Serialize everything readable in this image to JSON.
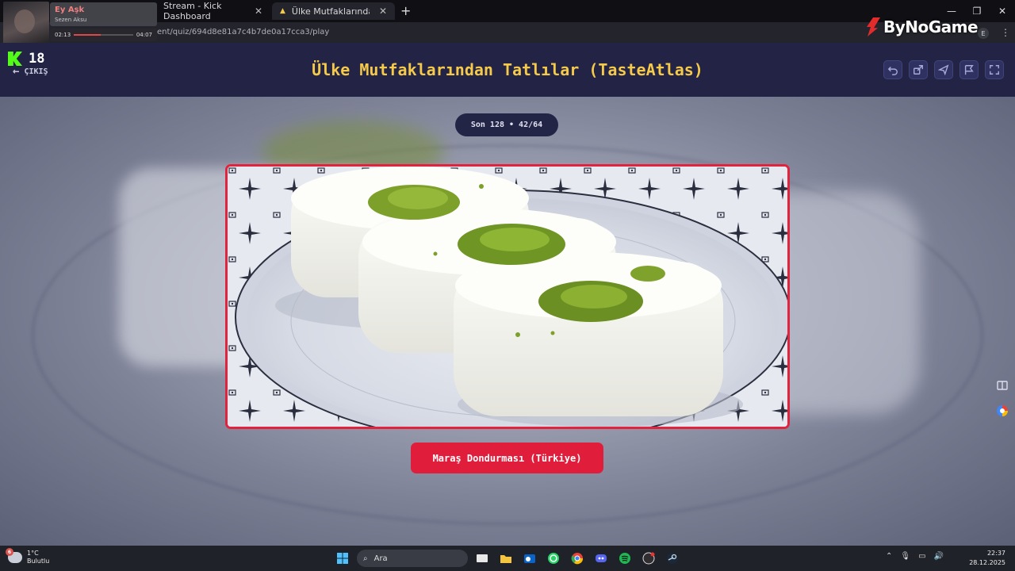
{
  "browser": {
    "tabs": [
      {
        "label": "Stream - Kick Dashboard"
      },
      {
        "label": "Ülke Mutfaklarından Tatlılar (Ta"
      }
    ],
    "url": "ent/quiz/694d8e81a7c4b7de0a17cca3/play",
    "profile_initial": "E"
  },
  "music_overlay": {
    "song": "Ey Aşk",
    "artist": "Sezen Aksu",
    "elapsed": "02:13",
    "total": "04:07",
    "progress": 0.45
  },
  "watermark": "ByNoGame",
  "header": {
    "kick_count": "18",
    "exit_label": "ÇIKIŞ",
    "title": "Ülke Mutfaklarından Tatlılar (TasteAtlas)",
    "tools": [
      "undo-icon",
      "share-icon",
      "send-icon",
      "flag-icon",
      "fullscreen-icon"
    ]
  },
  "quiz": {
    "round": "Son 128 • 42/64",
    "answer": "Maraş Dondurması (Türkiye)"
  },
  "colors": {
    "accent_red": "#e11d3c",
    "title_yellow": "#f5c94a",
    "header_bg": "#222345",
    "kick_green": "#53fc18"
  },
  "taskbar": {
    "weather_temp": "1°C",
    "weather_desc": "Bulutlu",
    "weather_badge": "6",
    "search_placeholder": "Ara",
    "time": "22:37",
    "date": "28.12.2025"
  }
}
